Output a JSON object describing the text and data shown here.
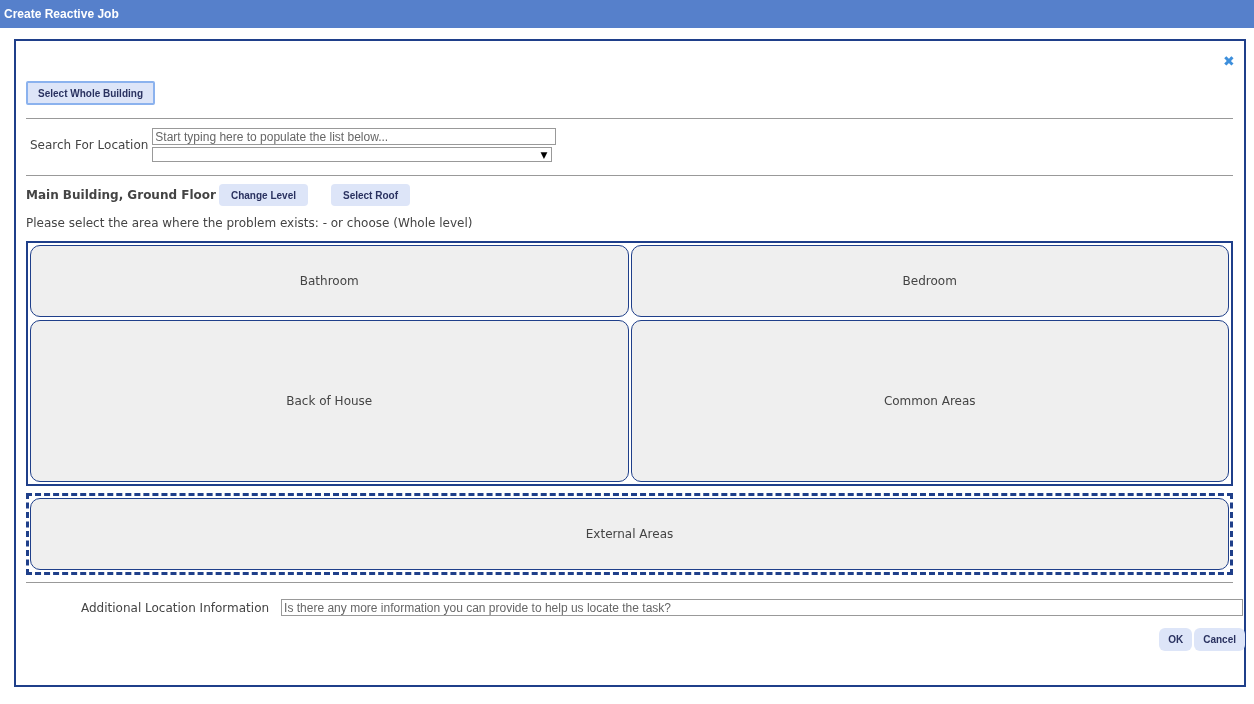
{
  "window": {
    "title": "Create Reactive Job",
    "close": "✖"
  },
  "select_whole_building": {
    "label": "Select Whole Building",
    "focused": true
  },
  "search": {
    "label": "Search For Location",
    "placeholder": "Start typing here to populate the list below...",
    "dropdown_arrow": "▼"
  },
  "level": {
    "name": "Main Building, Ground Floor",
    "buttons": [
      "Change Level",
      "Select Roof"
    ]
  },
  "instruction": "Please select the area where the problem exists: - or choose (Whole level)",
  "area_groups": [
    {
      "kind": "solid",
      "rows": [
        [
          "Bathroom",
          "Bedroom"
        ],
        [
          "Back of House",
          "Common Areas"
        ]
      ]
    },
    {
      "kind": "dashed",
      "rows": [
        [
          "External Areas"
        ]
      ]
    }
  ],
  "additional_info": {
    "label": "Additional Location Information",
    "placeholder": "Is there any more information you can provide to help us locate the task?"
  },
  "buttons": [
    "OK",
    "Cancel"
  ]
}
